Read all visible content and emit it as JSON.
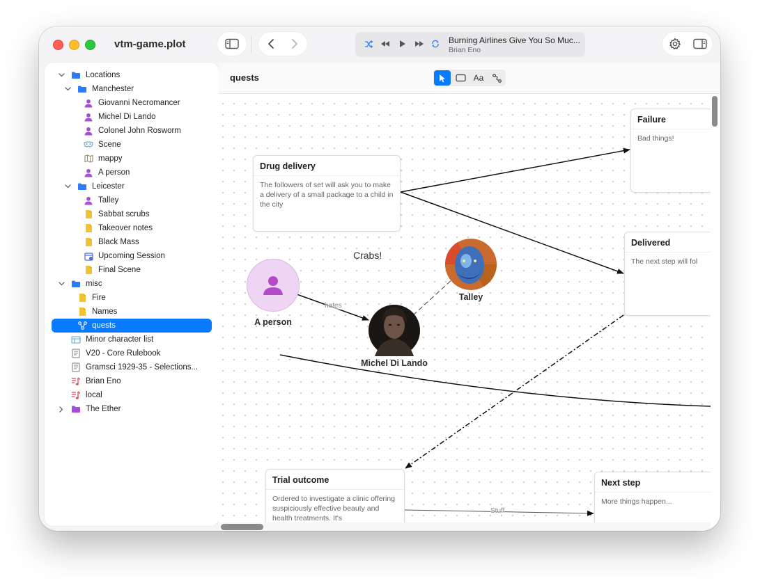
{
  "window": {
    "title": "vtm-game.plot"
  },
  "player": {
    "track": "Burning Airlines Give You So Muc...",
    "artist": "Brian Eno"
  },
  "sidebar": {
    "items": [
      {
        "label": "Locations",
        "icon": "folder-icon",
        "color": "#2d7cf6"
      },
      {
        "label": "Manchester",
        "icon": "folder-icon",
        "color": "#2d7cf6"
      },
      {
        "label": "Giovanni Necromancer",
        "icon": "person-icon",
        "color": "#a54fd6"
      },
      {
        "label": "Michel Di Lando",
        "icon": "person-icon",
        "color": "#a54fd6"
      },
      {
        "label": "Colonel John Rosworm",
        "icon": "person-icon",
        "color": "#a54fd6"
      },
      {
        "label": "Scene",
        "icon": "mask-icon",
        "color": "#7aa7c7"
      },
      {
        "label": "mappy",
        "icon": "map-icon",
        "color": "#9a8b6a"
      },
      {
        "label": "A person",
        "icon": "person-icon",
        "color": "#a54fd6"
      },
      {
        "label": "Leicester",
        "icon": "folder-icon",
        "color": "#2d7cf6"
      },
      {
        "label": "Talley",
        "icon": "person-icon",
        "color": "#a54fd6"
      },
      {
        "label": "Sabbat scrubs",
        "icon": "note-icon",
        "color": "#f2c230"
      },
      {
        "label": "Takeover notes",
        "icon": "note-icon",
        "color": "#f2c230"
      },
      {
        "label": "Black Mass",
        "icon": "note-icon",
        "color": "#f2c230"
      },
      {
        "label": "Upcoming Session",
        "icon": "calendar-icon",
        "color": "#4f6bd6"
      },
      {
        "label": "Final Scene",
        "icon": "note-icon",
        "color": "#f2c230"
      },
      {
        "label": "misc",
        "icon": "folder-icon",
        "color": "#2d7cf6"
      },
      {
        "label": "Fire",
        "icon": "note-icon",
        "color": "#f2c230"
      },
      {
        "label": "Names",
        "icon": "note-icon",
        "color": "#f2c230"
      },
      {
        "label": "quests",
        "icon": "graph-icon",
        "color": "#ffffff"
      },
      {
        "label": "Minor character list",
        "icon": "table-icon",
        "color": "#58a6c8"
      },
      {
        "label": "V20 - Core Rulebook",
        "icon": "pdf-icon",
        "color": "#777777"
      },
      {
        "label": "Gramsci 1929-35 - Selections...",
        "icon": "pdf-icon",
        "color": "#777777"
      },
      {
        "label": "Brian Eno",
        "icon": "music-icon",
        "color": "#e0445c"
      },
      {
        "label": "local",
        "icon": "music-icon",
        "color": "#e0445c"
      },
      {
        "label": "The Ether",
        "icon": "folder-icon",
        "color": "#a54fd6"
      }
    ]
  },
  "content": {
    "title": "quests",
    "tools": {
      "text_label": "Aa"
    }
  },
  "canvas": {
    "cards": {
      "drug": {
        "title": "Drug delivery",
        "body": "The followers of set will ask you to make a delivery of a small package to a child in the city"
      },
      "failure": {
        "title": "Failure",
        "body": "Bad things!"
      },
      "delivered": {
        "title": "Delivered",
        "body": "The next  step will fol"
      },
      "trial": {
        "title": "Trial outcome",
        "body": "Ordered to investigate a clinic offering suspiciously effective beauty and health treatments. It's"
      },
      "next": {
        "title": "Next step",
        "body": "More things happen..."
      }
    },
    "people": {
      "a_person": "A person",
      "michel": "Michel Di Lando",
      "talley": "Talley"
    },
    "edges": {
      "hates": "hates",
      "stuff": "Stuff"
    },
    "free_text": "Crabs!"
  }
}
